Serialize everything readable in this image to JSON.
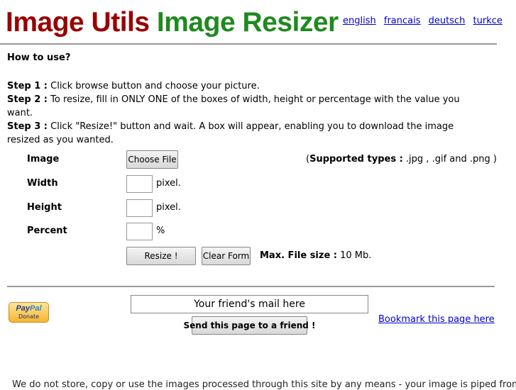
{
  "header": {
    "title_part1": "Image Utils",
    "title_part2": "Image Resizer",
    "languages": [
      "english",
      "francais",
      "deutsch",
      "turkce"
    ]
  },
  "instructions": {
    "heading": "How to use?",
    "steps": [
      {
        "label": "Step 1 :",
        "text": " Click browse button and choose your picture."
      },
      {
        "label": "Step 2 :",
        "text": " To resize, fill in ONLY ONE of the boxes of width, height or percentage with the value you want."
      },
      {
        "label": "Step 3 :",
        "text": " Click \"Resize!\" button and wait. A box will appear, enabling you to download the image resized as you wanted."
      }
    ]
  },
  "form": {
    "image_label": "Image",
    "choose_file": "Choose File",
    "supported_open": "(",
    "supported_label": "Supported types :",
    "supported_value": " .jpg , .gif and .png )",
    "width_label": "Width",
    "height_label": "Height",
    "percent_label": "Percent",
    "pixel_unit": "pixel.",
    "percent_unit": "%",
    "width_value": "",
    "height_value": "",
    "percent_value": "",
    "resize_button": "Resize !",
    "clear_button": "Clear Form",
    "max_label": "Max. File size :",
    "max_value": " 10 Mb."
  },
  "footer": {
    "paypal_logo_a": "Pay",
    "paypal_logo_b": "Pal",
    "paypal_donate": "Donate",
    "mail_placeholder": "Your friend's mail here",
    "send_button": "Send this page to a friend !",
    "bookmark_link": "Bookmark this page here",
    "disclaimer": "We do not store, copy or use the images processed through this site by any means - your image is piped from the"
  },
  "colors": {
    "title1": "#990000",
    "title2": "#1f8a1f",
    "link": "#0000cc"
  }
}
